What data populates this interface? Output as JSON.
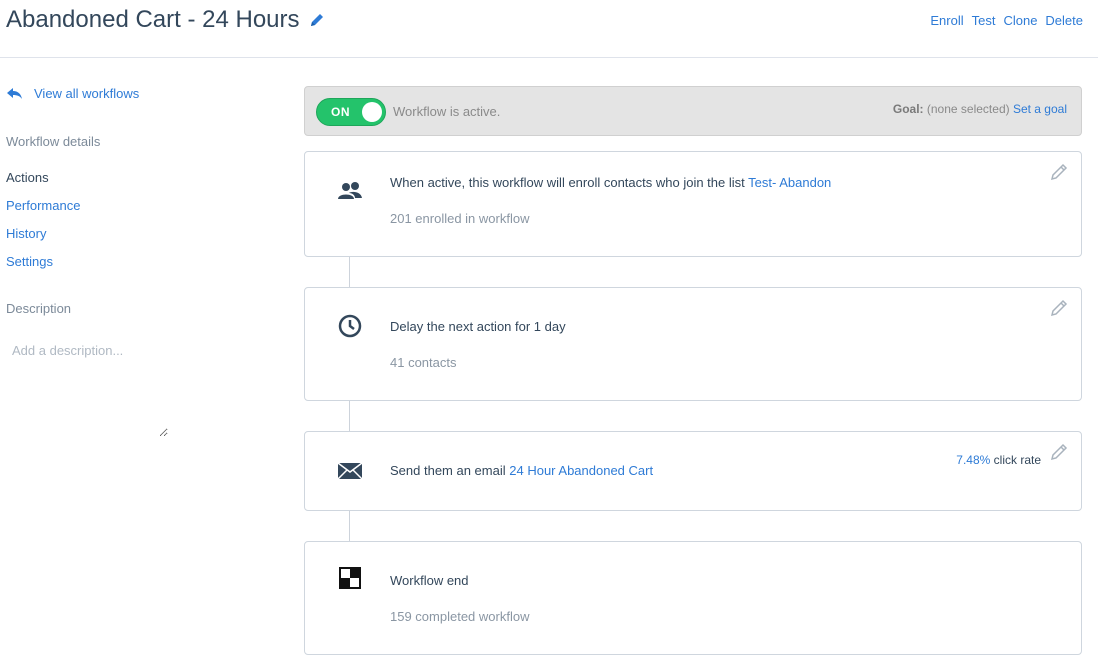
{
  "header": {
    "title": "Abandoned Cart - 24 Hours",
    "actions": [
      "Enroll",
      "Test",
      "Clone",
      "Delete"
    ]
  },
  "sidebar": {
    "back_label": "View all workflows",
    "details_heading": "Workflow details",
    "nav": [
      "Actions",
      "Performance",
      "History",
      "Settings"
    ],
    "active_nav": "Actions",
    "description_heading": "Description",
    "description_placeholder": "Add a description..."
  },
  "status": {
    "toggle_label": "ON",
    "toggle_on": true,
    "text": "Workflow is active.",
    "goal_label": "Goal:",
    "goal_value": "(none selected)",
    "goal_link": "Set a goal"
  },
  "steps": [
    {
      "icon": "contacts-icon",
      "text": "When active, this workflow will enroll contacts who join the list",
      "link": "Test- Abandon",
      "sub": "201 enrolled in workflow"
    },
    {
      "icon": "clock-icon",
      "text": "Delay the next action for 1 day",
      "sub": "41 contacts"
    },
    {
      "icon": "envelope-icon",
      "text": "Send them an email",
      "link": "24 Hour Abandoned Cart",
      "rate_value": "7.48%",
      "rate_label": "click rate"
    },
    {
      "icon": "finish-flag-icon",
      "text": "Workflow end",
      "sub": "159 completed workflow"
    }
  ],
  "colors": {
    "link": "#2e7bd6",
    "toggle_on": "#24c36b",
    "text": "#33475b"
  }
}
